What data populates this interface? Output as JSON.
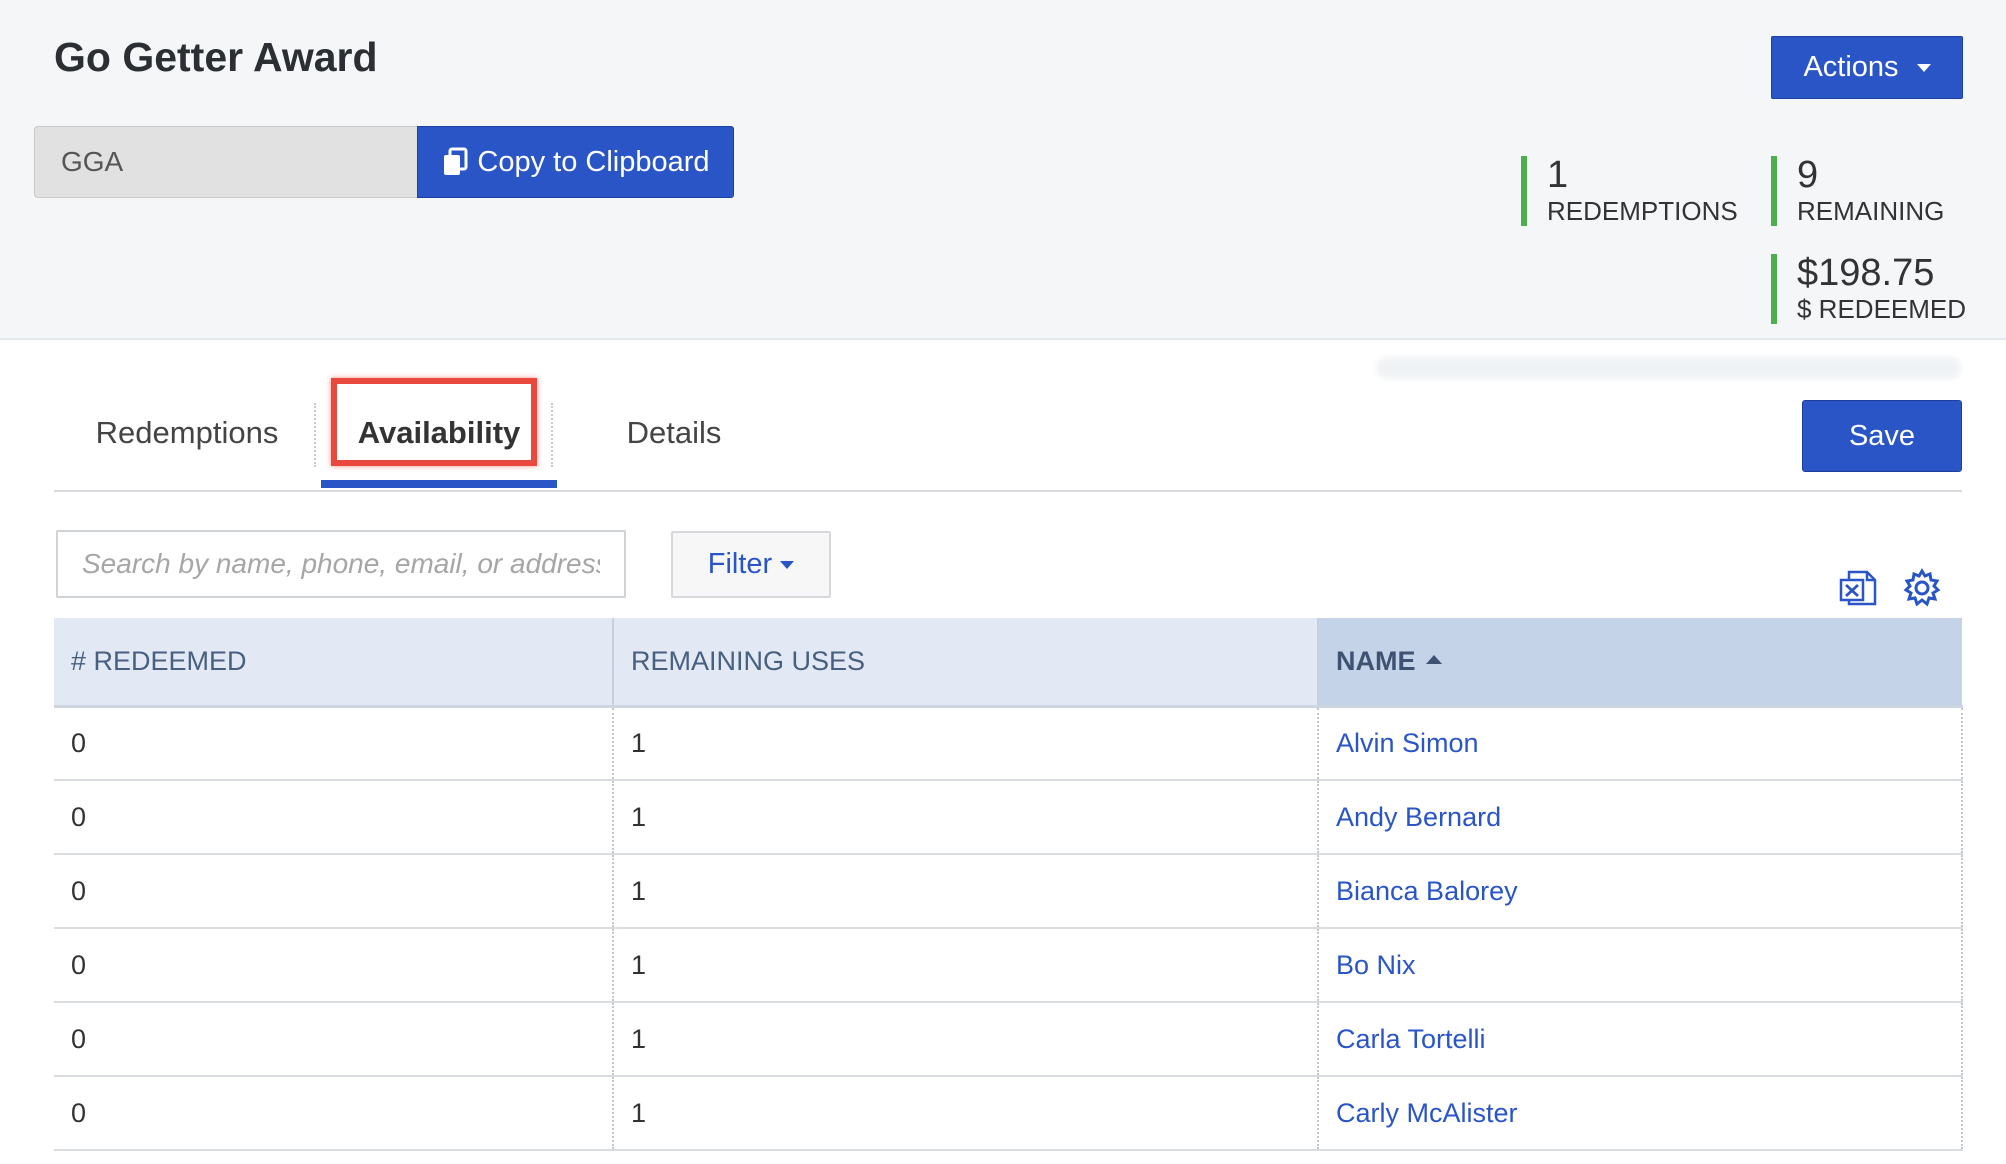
{
  "header": {
    "title": "Go Getter Award",
    "actions_label": "Actions",
    "code_value": "GGA",
    "copy_label": "Copy to Clipboard",
    "stats": [
      {
        "value": "1",
        "label": "REDEMPTIONS"
      },
      {
        "value": "9",
        "label": "REMAINING"
      },
      {
        "value": "$198.75",
        "label": "$ REDEEMED"
      }
    ],
    "accent_color": "#4cae4c"
  },
  "tabs": [
    {
      "label": "Redemptions",
      "active": false
    },
    {
      "label": "Availability",
      "active": true
    },
    {
      "label": "Details",
      "active": false
    }
  ],
  "save_label": "Save",
  "search": {
    "placeholder": "Search by name, phone, email, or address",
    "value": ""
  },
  "filter_label": "Filter",
  "toolbar_icons": [
    "excel-export-icon",
    "gear-icon"
  ],
  "table": {
    "columns": [
      "# REDEEMED",
      "REMAINING USES",
      "NAME"
    ],
    "sorted_column": "NAME",
    "sort_direction": "ascending",
    "rows": [
      {
        "redeemed": "0",
        "remaining": "1",
        "name": "Alvin Simon"
      },
      {
        "redeemed": "0",
        "remaining": "1",
        "name": "Andy Bernard"
      },
      {
        "redeemed": "0",
        "remaining": "1",
        "name": "Bianca Balorey"
      },
      {
        "redeemed": "0",
        "remaining": "1",
        "name": "Bo Nix"
      },
      {
        "redeemed": "0",
        "remaining": "1",
        "name": "Carla Tortelli"
      },
      {
        "redeemed": "0",
        "remaining": "1",
        "name": "Carly McAlister"
      }
    ]
  },
  "colors": {
    "primary": "#2a55c6",
    "highlight": "#e8483e"
  }
}
